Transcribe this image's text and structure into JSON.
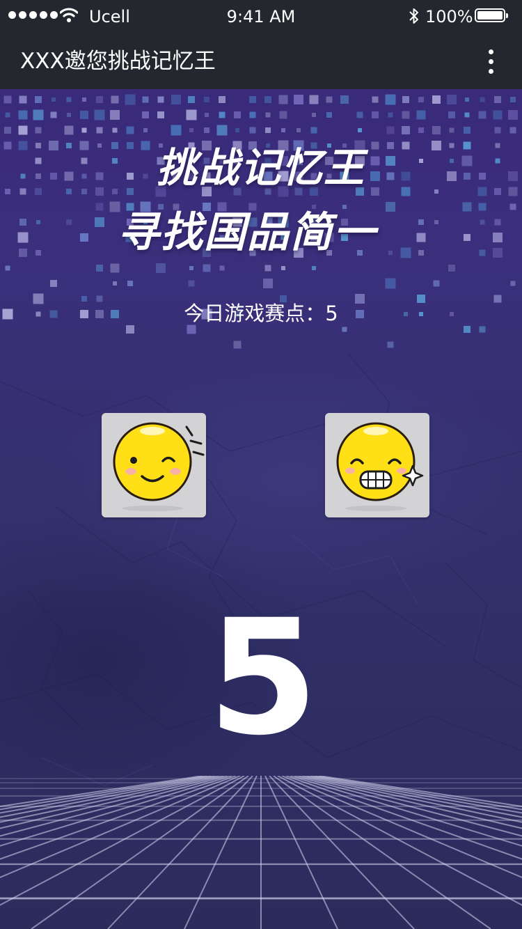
{
  "status_bar": {
    "carrier": "Ucell",
    "time": "9:41 AM",
    "battery": "100%"
  },
  "nav": {
    "title": "XXX邀您挑战记忆王",
    "more_icon": "more-vertical-icon"
  },
  "game": {
    "title_line1": "挑战记忆王",
    "title_line2": "寻找国品简一",
    "score_label": "今日游戏赛点：5",
    "countdown": "5",
    "cards": [
      {
        "icon": "winking-smiley-icon"
      },
      {
        "icon": "grinning-smiley-icon"
      }
    ]
  },
  "colors": {
    "bar_background": "#25272e",
    "background_top": "#3a2a7a",
    "background_bottom": "#2c2b5c",
    "card_background": "#d3d2d5",
    "smiley_yellow": "#ffe017"
  }
}
